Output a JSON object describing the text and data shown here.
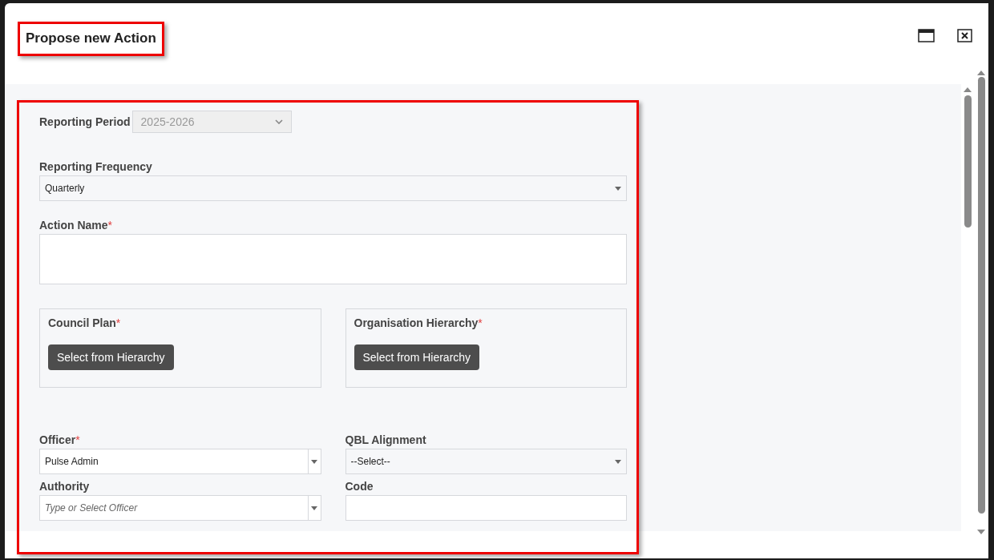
{
  "dialog": {
    "title": "Propose new Action"
  },
  "required_mark": "*",
  "reporting_period": {
    "label": "Reporting Period",
    "value": "2025-2026",
    "disabled": true
  },
  "reporting_frequency": {
    "label": "Reporting Frequency",
    "value": "Quarterly"
  },
  "action_name": {
    "label": "Action Name",
    "required": true
  },
  "hierarchy_panels": [
    {
      "label": "Council Plan",
      "required": true,
      "button": "Select from Hierarchy"
    },
    {
      "label": "Organisation Hierarchy",
      "required": true,
      "button": "Select from Hierarchy"
    }
  ],
  "fields": [
    {
      "kind": "combobox",
      "label": "Officer",
      "required": true,
      "value": "Pulse Admin"
    },
    {
      "kind": "select",
      "label": "QBL Alignment",
      "required": false,
      "value": "--Select--"
    },
    {
      "kind": "combobox",
      "label": "Authority",
      "required": false,
      "placeholder": "Type or Select Officer"
    },
    {
      "kind": "text",
      "label": "Code",
      "required": false
    }
  ]
}
